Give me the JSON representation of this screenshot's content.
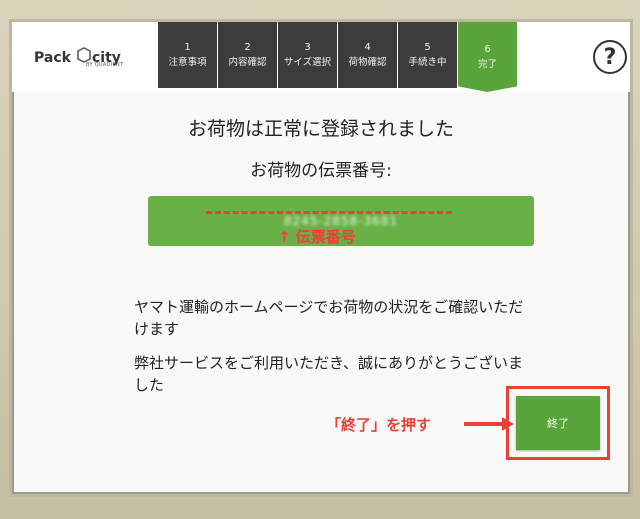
{
  "header": {
    "logo_text": "Pack city",
    "logo_sub": "BY QUADIENT",
    "steps": [
      {
        "num": "1",
        "label": "注意事項"
      },
      {
        "num": "2",
        "label": "内容確認"
      },
      {
        "num": "3",
        "label": "サイズ選択"
      },
      {
        "num": "4",
        "label": "荷物確認"
      },
      {
        "num": "5",
        "label": "手続き中"
      },
      {
        "num": "6",
        "label": "完了"
      }
    ],
    "help_label": "?"
  },
  "main": {
    "title": "お荷物は正常に登録されました",
    "tracking_label": "お荷物の伝票番号:",
    "tracking_value": "8245-2858-3681",
    "tracking_annotation": "↑ 伝票番号",
    "info_1": "ヤマト運輸のホームページでお荷物の状況をご確認いただけます",
    "info_2": "弊社サービスをご利用いただき、誠にありがとうございました",
    "press_annotation": "「終了」を押す",
    "finish_label": "終了"
  },
  "colors": {
    "accent_green": "#5aa53b",
    "step_dark": "#3c3c3c",
    "annotation_red": "#e8413a"
  }
}
